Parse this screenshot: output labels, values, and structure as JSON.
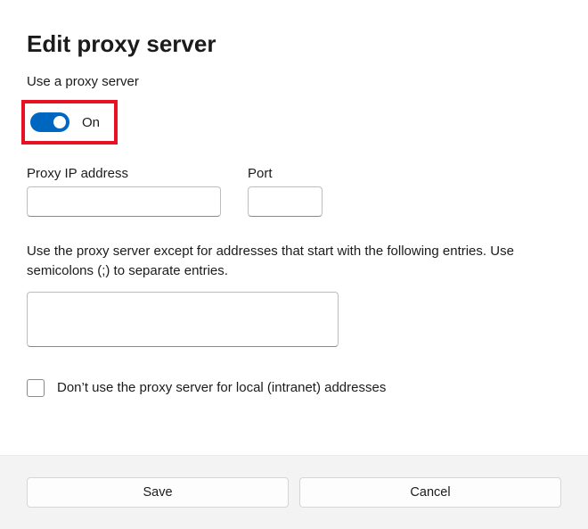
{
  "dialog": {
    "title": "Edit proxy server",
    "useProxyLabel": "Use a proxy server",
    "toggle": {
      "state": "On"
    },
    "ipField": {
      "label": "Proxy IP address",
      "value": ""
    },
    "portField": {
      "label": "Port",
      "value": ""
    },
    "exceptionsHelp": "Use the proxy server except for addresses that start with the following entries. Use semicolons (;) to separate entries.",
    "exceptionsValue": "",
    "bypassLocal": {
      "label": "Don’t use the proxy server for local (intranet) addresses",
      "checked": false
    },
    "buttons": {
      "save": "Save",
      "cancel": "Cancel"
    }
  },
  "colors": {
    "accent": "#0067c0",
    "highlight": "#e81123"
  }
}
